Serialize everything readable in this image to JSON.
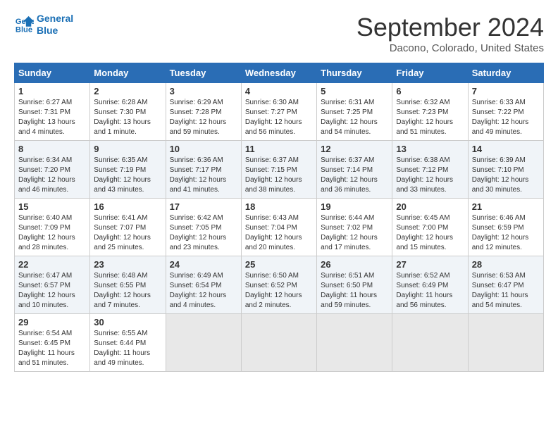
{
  "logo": {
    "line1": "General",
    "line2": "Blue"
  },
  "title": "September 2024",
  "subtitle": "Dacono, Colorado, United States",
  "days_of_week": [
    "Sunday",
    "Monday",
    "Tuesday",
    "Wednesday",
    "Thursday",
    "Friday",
    "Saturday"
  ],
  "weeks": [
    [
      {
        "day": "1",
        "info": "Sunrise: 6:27 AM\nSunset: 7:31 PM\nDaylight: 13 hours\nand 4 minutes."
      },
      {
        "day": "2",
        "info": "Sunrise: 6:28 AM\nSunset: 7:30 PM\nDaylight: 13 hours\nand 1 minute."
      },
      {
        "day": "3",
        "info": "Sunrise: 6:29 AM\nSunset: 7:28 PM\nDaylight: 12 hours\nand 59 minutes."
      },
      {
        "day": "4",
        "info": "Sunrise: 6:30 AM\nSunset: 7:27 PM\nDaylight: 12 hours\nand 56 minutes."
      },
      {
        "day": "5",
        "info": "Sunrise: 6:31 AM\nSunset: 7:25 PM\nDaylight: 12 hours\nand 54 minutes."
      },
      {
        "day": "6",
        "info": "Sunrise: 6:32 AM\nSunset: 7:23 PM\nDaylight: 12 hours\nand 51 minutes."
      },
      {
        "day": "7",
        "info": "Sunrise: 6:33 AM\nSunset: 7:22 PM\nDaylight: 12 hours\nand 49 minutes."
      }
    ],
    [
      {
        "day": "8",
        "info": "Sunrise: 6:34 AM\nSunset: 7:20 PM\nDaylight: 12 hours\nand 46 minutes."
      },
      {
        "day": "9",
        "info": "Sunrise: 6:35 AM\nSunset: 7:19 PM\nDaylight: 12 hours\nand 43 minutes."
      },
      {
        "day": "10",
        "info": "Sunrise: 6:36 AM\nSunset: 7:17 PM\nDaylight: 12 hours\nand 41 minutes."
      },
      {
        "day": "11",
        "info": "Sunrise: 6:37 AM\nSunset: 7:15 PM\nDaylight: 12 hours\nand 38 minutes."
      },
      {
        "day": "12",
        "info": "Sunrise: 6:37 AM\nSunset: 7:14 PM\nDaylight: 12 hours\nand 36 minutes."
      },
      {
        "day": "13",
        "info": "Sunrise: 6:38 AM\nSunset: 7:12 PM\nDaylight: 12 hours\nand 33 minutes."
      },
      {
        "day": "14",
        "info": "Sunrise: 6:39 AM\nSunset: 7:10 PM\nDaylight: 12 hours\nand 30 minutes."
      }
    ],
    [
      {
        "day": "15",
        "info": "Sunrise: 6:40 AM\nSunset: 7:09 PM\nDaylight: 12 hours\nand 28 minutes."
      },
      {
        "day": "16",
        "info": "Sunrise: 6:41 AM\nSunset: 7:07 PM\nDaylight: 12 hours\nand 25 minutes."
      },
      {
        "day": "17",
        "info": "Sunrise: 6:42 AM\nSunset: 7:05 PM\nDaylight: 12 hours\nand 23 minutes."
      },
      {
        "day": "18",
        "info": "Sunrise: 6:43 AM\nSunset: 7:04 PM\nDaylight: 12 hours\nand 20 minutes."
      },
      {
        "day": "19",
        "info": "Sunrise: 6:44 AM\nSunset: 7:02 PM\nDaylight: 12 hours\nand 17 minutes."
      },
      {
        "day": "20",
        "info": "Sunrise: 6:45 AM\nSunset: 7:00 PM\nDaylight: 12 hours\nand 15 minutes."
      },
      {
        "day": "21",
        "info": "Sunrise: 6:46 AM\nSunset: 6:59 PM\nDaylight: 12 hours\nand 12 minutes."
      }
    ],
    [
      {
        "day": "22",
        "info": "Sunrise: 6:47 AM\nSunset: 6:57 PM\nDaylight: 12 hours\nand 10 minutes."
      },
      {
        "day": "23",
        "info": "Sunrise: 6:48 AM\nSunset: 6:55 PM\nDaylight: 12 hours\nand 7 minutes."
      },
      {
        "day": "24",
        "info": "Sunrise: 6:49 AM\nSunset: 6:54 PM\nDaylight: 12 hours\nand 4 minutes."
      },
      {
        "day": "25",
        "info": "Sunrise: 6:50 AM\nSunset: 6:52 PM\nDaylight: 12 hours\nand 2 minutes."
      },
      {
        "day": "26",
        "info": "Sunrise: 6:51 AM\nSunset: 6:50 PM\nDaylight: 11 hours\nand 59 minutes."
      },
      {
        "day": "27",
        "info": "Sunrise: 6:52 AM\nSunset: 6:49 PM\nDaylight: 11 hours\nand 56 minutes."
      },
      {
        "day": "28",
        "info": "Sunrise: 6:53 AM\nSunset: 6:47 PM\nDaylight: 11 hours\nand 54 minutes."
      }
    ],
    [
      {
        "day": "29",
        "info": "Sunrise: 6:54 AM\nSunset: 6:45 PM\nDaylight: 11 hours\nand 51 minutes."
      },
      {
        "day": "30",
        "info": "Sunrise: 6:55 AM\nSunset: 6:44 PM\nDaylight: 11 hours\nand 49 minutes."
      },
      {
        "day": "",
        "info": ""
      },
      {
        "day": "",
        "info": ""
      },
      {
        "day": "",
        "info": ""
      },
      {
        "day": "",
        "info": ""
      },
      {
        "day": "",
        "info": ""
      }
    ]
  ]
}
